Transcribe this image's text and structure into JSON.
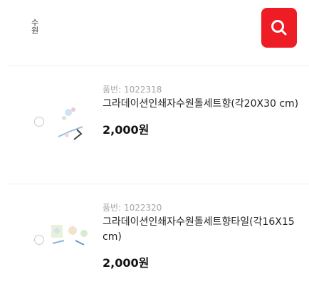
{
  "search": {
    "query": "수원",
    "button_icon": "search-icon",
    "button_color": "#ee1c25"
  },
  "products": [
    {
      "code": "품번: 1022318",
      "name": "그라데이션인쇄자수원돌세트향(각20X30 cm)",
      "price": "2,000원",
      "thumb_icon": "product-image"
    },
    {
      "code": "품번: 1022320",
      "name": "그라데이션인쇄자수원돌세트향타일(각16X15 cm)",
      "price": "2,000원",
      "thumb_icon": "product-image"
    }
  ]
}
